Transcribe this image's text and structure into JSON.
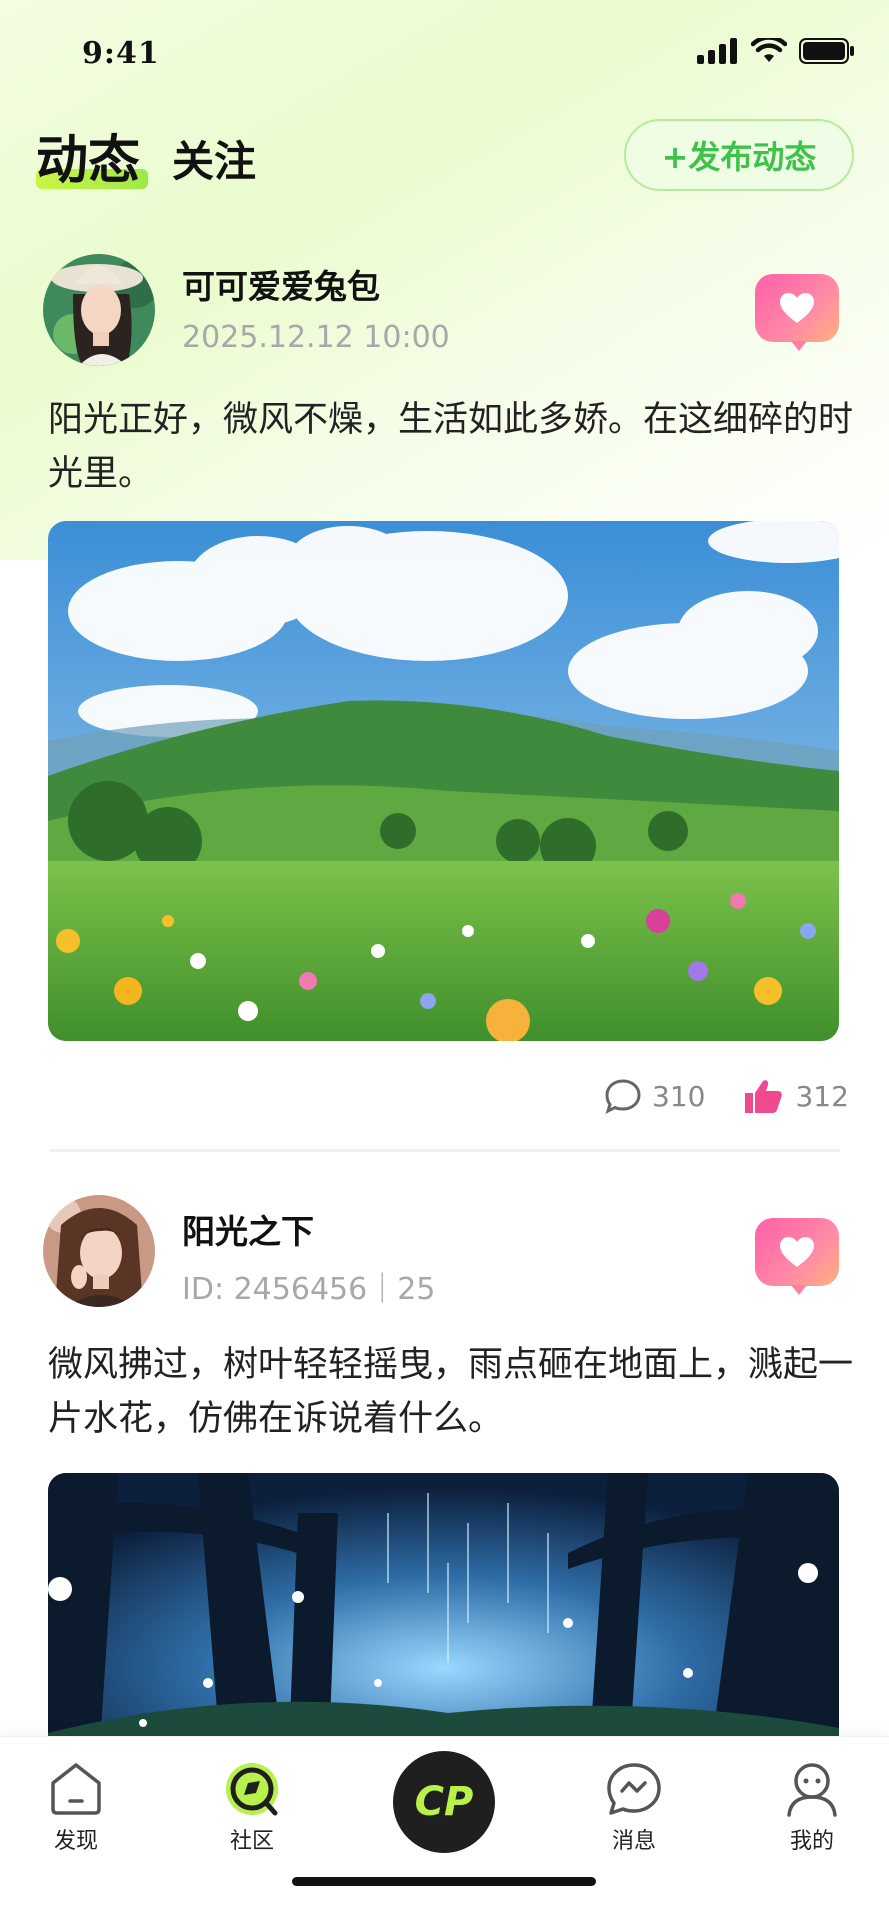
{
  "status_bar": {
    "time": "9:41"
  },
  "header": {
    "tab_active": "动态",
    "tab_inactive": "关注",
    "publish_button": "+发布动态"
  },
  "posts": [
    {
      "username": "可可爱爱兔包",
      "meta": "2025.12.12 10:00",
      "text": "阳光正好，微风不燥，生活如此多娇。在这细碎的时光里。",
      "comments": "310",
      "likes": "312",
      "image": "sunny-meadow-landscape"
    },
    {
      "username": "阳光之下",
      "meta": "ID: 2456456｜25",
      "text": "微风拂过，树叶轻轻摇曳，雨点砸在地面上，溅起一片水花，仿佛在诉说着什么。",
      "image": "glowing-night-forest"
    }
  ],
  "tabbar": {
    "items": [
      {
        "label": "发现",
        "icon": "home-icon"
      },
      {
        "label": "社区",
        "icon": "community-icon"
      },
      {
        "label": "CP",
        "icon": "cp-icon"
      },
      {
        "label": "消息",
        "icon": "message-icon"
      },
      {
        "label": "我的",
        "icon": "profile-icon"
      }
    ]
  },
  "colors": {
    "accent_green": "#3ec24a",
    "highlight_lime": "#c9f545",
    "like_pink": "#ff5ea8"
  }
}
